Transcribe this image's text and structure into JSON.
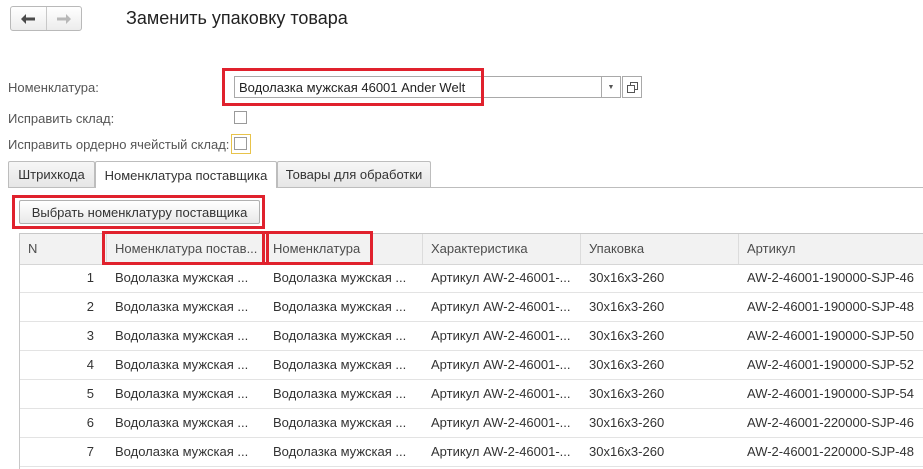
{
  "window": {
    "title": "Заменить упаковку товара",
    "nav_back_glyph": "🡐",
    "nav_forward_glyph": "🡒"
  },
  "form": {
    "nomenclature_label": "Номенклатура:",
    "nomenclature_value": "Водолазка мужская 46001 Ander Welt",
    "fix_warehouse_label": "Исправить склад:",
    "fix_cell_warehouse_label": "Исправить ордерно ячейстый склад:",
    "fix_warehouse_checked": false,
    "fix_cell_warehouse_checked": false
  },
  "tabs": [
    {
      "label": "Штрихкода",
      "active": false
    },
    {
      "label": "Номенклатура поставщика",
      "active": true
    },
    {
      "label": "Товары для обработки",
      "active": false
    }
  ],
  "toolbar": {
    "select_supplier_label": "Выбрать номенклатуру поставщика"
  },
  "table": {
    "columns": [
      "N",
      "Номенклатура постав...",
      "Номенклатура",
      "Характеристика",
      "Упаковка",
      "Артикул"
    ],
    "rows": [
      {
        "n": "1",
        "supplier": "Водолазка мужская ...",
        "nomenclature": "Водолазка мужская ...",
        "characteristic": "Артикул AW-2-46001-...",
        "package": "30x16x3-260",
        "article": "AW-2-46001-190000-SJP-46"
      },
      {
        "n": "2",
        "supplier": "Водолазка мужская ...",
        "nomenclature": "Водолазка мужская ...",
        "characteristic": "Артикул AW-2-46001-...",
        "package": "30x16x3-260",
        "article": "AW-2-46001-190000-SJP-48"
      },
      {
        "n": "3",
        "supplier": "Водолазка мужская ...",
        "nomenclature": "Водолазка мужская ...",
        "characteristic": "Артикул AW-2-46001-...",
        "package": "30x16x3-260",
        "article": "AW-2-46001-190000-SJP-50"
      },
      {
        "n": "4",
        "supplier": "Водолазка мужская ...",
        "nomenclature": "Водолазка мужская ...",
        "characteristic": "Артикул AW-2-46001-...",
        "package": "30x16x3-260",
        "article": "AW-2-46001-190000-SJP-52"
      },
      {
        "n": "5",
        "supplier": "Водолазка мужская ...",
        "nomenclature": "Водолазка мужская ...",
        "characteristic": "Артикул AW-2-46001-...",
        "package": "30x16x3-260",
        "article": "AW-2-46001-190000-SJP-54"
      },
      {
        "n": "6",
        "supplier": "Водолазка мужская ...",
        "nomenclature": "Водолазка мужская ...",
        "characteristic": "Артикул AW-2-46001-...",
        "package": "30x16x3-260",
        "article": "AW-2-46001-220000-SJP-46"
      },
      {
        "n": "7",
        "supplier": "Водолазка мужская ...",
        "nomenclature": "Водолазка мужская ...",
        "characteristic": "Артикул AW-2-46001-...",
        "package": "30x16x3-260",
        "article": "AW-2-46001-220000-SJP-48"
      }
    ]
  },
  "colors": {
    "highlight": "#e0212d",
    "checkbox_focus": "#e8c34a"
  }
}
